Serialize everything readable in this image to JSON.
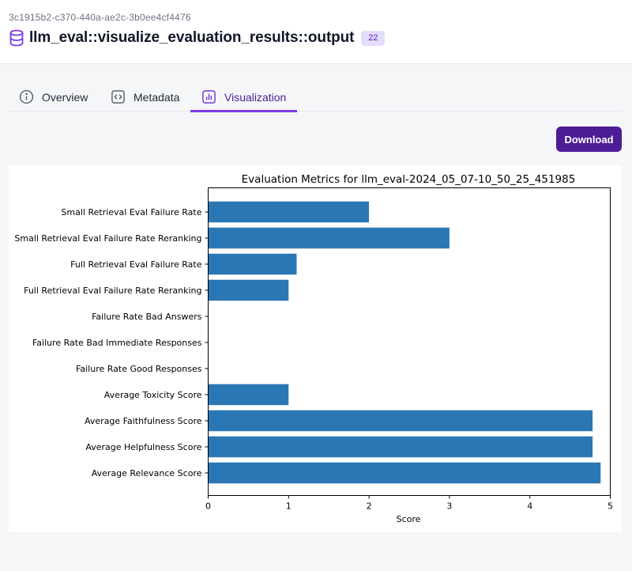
{
  "header": {
    "artifact_id": "3c1915b2-c370-440a-ae2c-3b0ee4cf4476",
    "title": "llm_eval::visualize_evaluation_results::output",
    "badge": "22",
    "icon": "database-icon"
  },
  "tabs": [
    {
      "label": "Overview",
      "icon": "info-icon",
      "active": false
    },
    {
      "label": "Metadata",
      "icon": "code-icon",
      "active": false
    },
    {
      "label": "Visualization",
      "icon": "bar-chart-icon",
      "active": true
    }
  ],
  "actions": {
    "download_label": "Download"
  },
  "colors": {
    "accent": "#7c3aed",
    "button": "#4c1d95",
    "bar": "#2b77b4",
    "badge_bg": "#e4dcfb"
  },
  "chart_data": {
    "type": "bar",
    "orientation": "horizontal",
    "title": "Evaluation Metrics for llm_eval-2024_05_07-10_50_25_451985",
    "xlabel": "Score",
    "ylabel": "",
    "xlim": [
      0,
      5
    ],
    "xticks": [
      "0",
      "1",
      "2",
      "3",
      "4",
      "5"
    ],
    "categories": [
      "Small Retrieval Eval Failure Rate",
      "Small Retrieval Eval Failure Rate Reranking",
      "Full Retrieval Eval Failure Rate",
      "Full Retrieval Eval Failure Rate Reranking",
      "Failure Rate Bad Answers",
      "Failure Rate Bad Immediate Responses",
      "Failure Rate Good Responses",
      "Average Toxicity Score",
      "Average Faithfulness Score",
      "Average Helpfulness Score",
      "Average Relevance Score"
    ],
    "values": [
      2.0,
      3.0,
      1.1,
      1.0,
      0,
      0,
      0,
      1.0,
      4.78,
      4.78,
      4.88
    ],
    "grid": false,
    "legend": "none"
  }
}
